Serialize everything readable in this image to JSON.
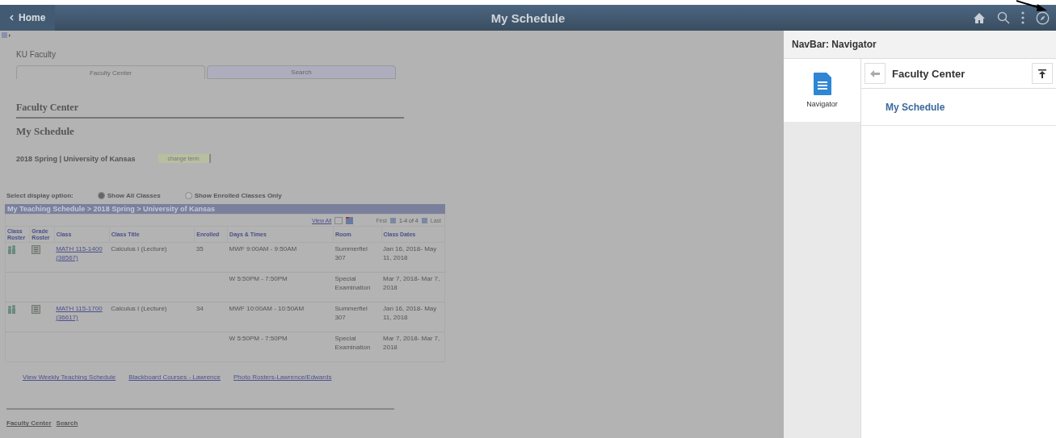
{
  "header": {
    "back_label": "Home",
    "title": "My Schedule"
  },
  "left": {
    "portal_title": "KU Faculty",
    "tabs": [
      {
        "label": "Faculty Center",
        "selected": true
      },
      {
        "label": "Search",
        "selected": false
      }
    ],
    "page_heading": "Faculty Center",
    "subheading": "My Schedule",
    "term": "2018 Spring | University of Kansas",
    "change_term": "change term",
    "display_option": {
      "label": "Select display option:",
      "options": [
        {
          "label": "Show All Classes",
          "selected": true
        },
        {
          "label": "Show Enrolled Classes Only",
          "selected": false
        }
      ]
    },
    "grid": {
      "title": "My Teaching Schedule > 2018 Spring > University of Kansas",
      "view_all": "View All",
      "first": "First",
      "range": "1-4 of 4",
      "last": "Last",
      "columns": [
        "Class Roster",
        "Grade Roster",
        "Class",
        "Class Title",
        "Enrolled",
        "Days & Times",
        "Room",
        "Class Dates"
      ],
      "rows": [
        {
          "kind": "class",
          "class": "MATH 115-1400 (38567)",
          "title": "Calculus I (Lecture)",
          "enrolled": "35",
          "days_times": "MWF 9:00AM - 9:50AM",
          "room": "Summerfiel 307",
          "dates": "Jan 16, 2018- May 11, 2018"
        },
        {
          "kind": "meeting",
          "days_times": "W 5:50PM - 7:50PM",
          "room": "Special Examination",
          "dates": "Mar 7, 2018- Mar 7, 2018"
        },
        {
          "kind": "class",
          "class": "MATH 115-1700 (36617)",
          "title": "Calculus I (Lecture)",
          "enrolled": "34",
          "days_times": "MWF 10:00AM - 10:50AM",
          "room": "Summerfiel 307",
          "dates": "Jan 16, 2018- May 11, 2018"
        },
        {
          "kind": "meeting",
          "days_times": "W 5:50PM - 7:50PM",
          "room": "Special Examination",
          "dates": "Mar 7, 2018- Mar 7, 2018"
        }
      ]
    },
    "links": [
      "View Weekly Teaching Schedule",
      "Blackboard Courses - Lawrence",
      "Photo Rosters-Lawrence/Edwards"
    ],
    "bottom_links": [
      "Faculty Center",
      "Search"
    ]
  },
  "navigator": {
    "title": "NavBar: Navigator",
    "tiles": [
      {
        "label": "Navigator",
        "selected": true
      }
    ],
    "folder": "Faculty Center",
    "items": [
      "My Schedule"
    ]
  }
}
